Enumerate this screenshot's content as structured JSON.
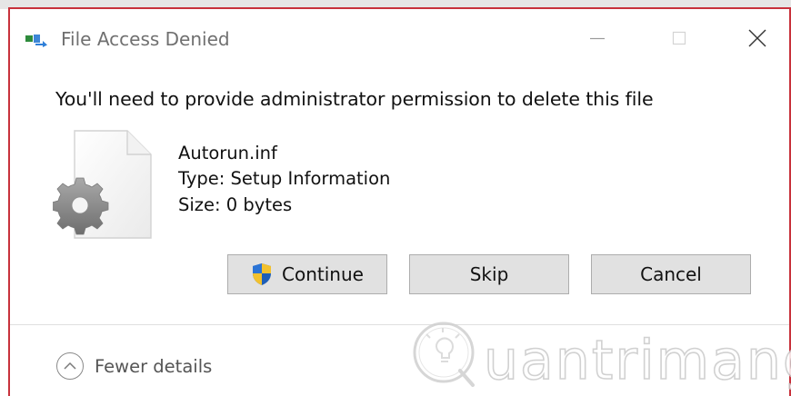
{
  "window": {
    "title": "File Access Denied",
    "controls": [
      "minimize-icon",
      "maximize-icon",
      "close-icon"
    ]
  },
  "message": "You'll need to provide administrator permission to delete this file",
  "file": {
    "name": "Autorun.inf",
    "type": "Type: Setup Information",
    "size": "Size: 0 bytes",
    "icon": "settings-file-icon"
  },
  "buttons": {
    "continue": "Continue",
    "skip": "Skip",
    "cancel": "Cancel",
    "continue_icon": "uac-shield-icon"
  },
  "details_toggle": {
    "label": "Fewer details",
    "icon": "chevron-up-icon"
  },
  "watermark": {
    "text": "uantrimang",
    "logo_letter": "Q"
  },
  "colors": {
    "window_border": "#c8323c",
    "button_bg": "#e1e1e1",
    "button_border": "#adadad",
    "title_text": "#707070"
  }
}
